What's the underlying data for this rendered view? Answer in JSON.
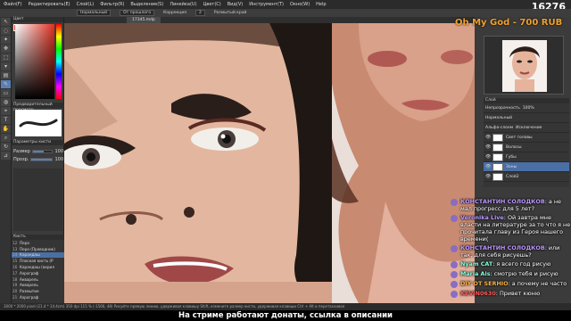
{
  "menubar": [
    "Файл(F)",
    "Редактировать(E)",
    "Слой(L)",
    "Фильтр(R)",
    "Выделение(S)",
    "Линейка(U)",
    "Цвет(C)",
    "Вид(V)",
    "Инструмент(T)",
    "Окно(W)",
    "Help"
  ],
  "tool_options": {
    "mode": "Нормальный",
    "smoothing": "От прошлого",
    "correction": "Коррекция",
    "correction_value": "2",
    "blur": "Размытый край"
  },
  "document_tab": "17345.mdp",
  "left_panel": {
    "color_title": "Цвет",
    "brush_preview_title": "Предварительный просмотр",
    "brush_params_title": "Параметры кисти",
    "size_label": "Размер",
    "size_value": "100",
    "opacity_label": "Прозр.",
    "opacity_value": "100",
    "opacity_percent": 1.0,
    "size_percent": 0.55,
    "brush_list_title": "Кисть",
    "brushes": [
      {
        "num": "12",
        "name": "Перо"
      },
      {
        "num": "13",
        "name": "Перо (Проводник)"
      },
      {
        "num": "14",
        "name": "Карандаш",
        "selected": true
      },
      {
        "num": "15",
        "name": "Плоская кисть (Р"
      },
      {
        "num": "16",
        "name": "Карандаш (акрил"
      },
      {
        "num": "17",
        "name": "Аэрограф"
      },
      {
        "num": "18",
        "name": "Акварель"
      },
      {
        "num": "19",
        "name": "Акварель"
      },
      {
        "num": "20",
        "name": "Размытие"
      },
      {
        "num": "21",
        "name": "Аэрограф"
      }
    ]
  },
  "counter": "16276",
  "donation": "Oh My God - 700 RUB",
  "layers": {
    "title": "Слой",
    "opacity_label": "Непрозрачность",
    "opacity_value": "100%",
    "blend_label": "Нормальный",
    "clip_label": "Альфа-слоем",
    "clip_label2": "Исключение",
    "items": [
      {
        "name": "Свет головы"
      },
      {
        "name": "Волосы"
      },
      {
        "name": "Губы"
      },
      {
        "name": "Зоны",
        "selected": true
      },
      {
        "name": "Слой2"
      }
    ]
  },
  "chat": [
    {
      "name": "КОНСТАНТИН СОЛОДКОВ",
      "text": "а не мал прогресс для 5 лет?",
      "name_color": "purple"
    },
    {
      "name": "Veronika Live",
      "text": "Ой завтра мне власти на литературе за то что я не прочитала главу из Героя нашего времени(",
      "name_color": "purple"
    },
    {
      "name": "КОНСТАНТИН СОЛОДКОВ",
      "text": "или так, для себя рисуешь?",
      "name_color": "purple"
    },
    {
      "name": "Nyam CAT",
      "text": "я всего год рисую",
      "name_color": "teal"
    },
    {
      "name": "Maria Ais",
      "text": "смотрю тебя и рисую",
      "name_color": "teal"
    },
    {
      "name": "DIY ОТ SERHIO",
      "text": "а почему не часто",
      "name_color": "orange"
    },
    {
      "name": "KEVIN0630",
      "text": "Привет кюню",
      "name_color": "red"
    }
  ],
  "status_bar": "3000 * 2000 pixel (21.4 * 14.4cm) 350 dpi 115 % (-1566, 48) Рисуйте прямую линию, удерживая клавишу Shift, измените размер кисти, удерживая клавиши Ctrl + Alt и перетаскивая",
  "caption": "На стриме работают донаты, ссылка в описании",
  "colors": {
    "accent": "#5a7fb5",
    "donation": "#f0a030"
  }
}
